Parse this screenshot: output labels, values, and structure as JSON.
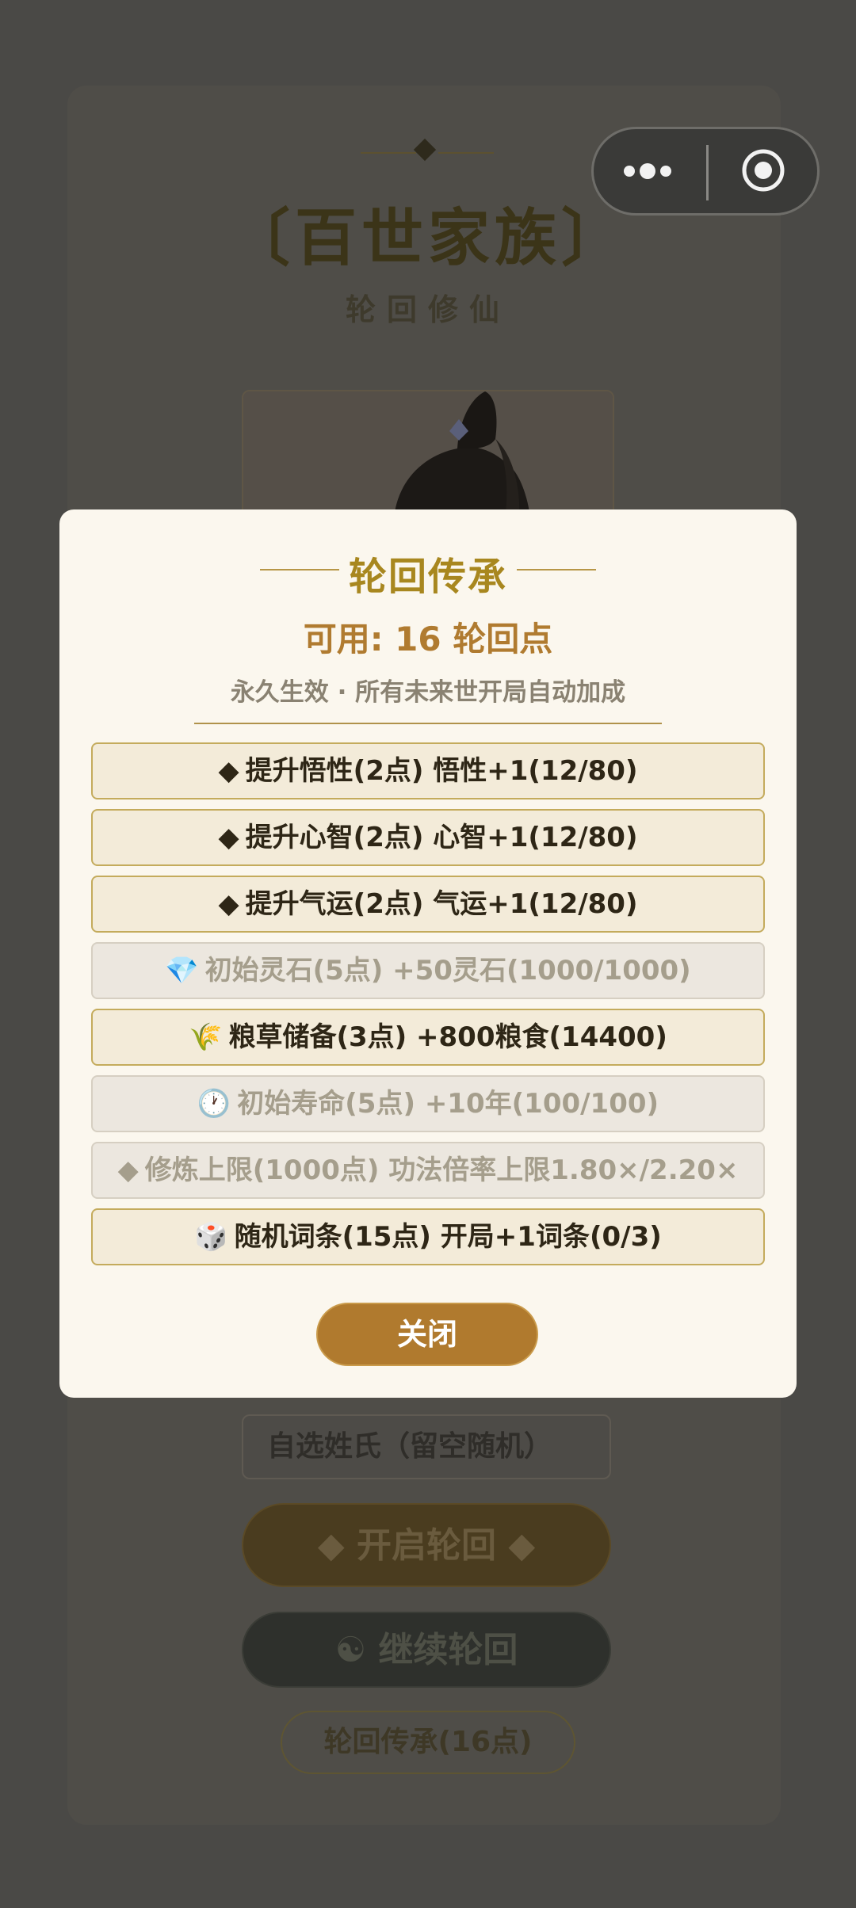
{
  "background": {
    "title": "〔百世家族〕",
    "subtitle": "轮回修仙",
    "surname_input": {
      "placeholder": "自选姓氏（留空随机）"
    },
    "start_button": "◆ 开启轮回 ◆",
    "continue_button": "☯ 继续轮回",
    "inherit_button": "轮回传承(16点)"
  },
  "modal": {
    "title": "轮回传承",
    "available_points": "可用: 16 轮回点",
    "description": "永久生效 · 所有未来世开局自动加成",
    "options": [
      {
        "icon": "◆",
        "label": "提升悟性(2点) 悟性+1(12/80)",
        "enabled": true
      },
      {
        "icon": "◆",
        "label": "提升心智(2点) 心智+1(12/80)",
        "enabled": true
      },
      {
        "icon": "◆",
        "label": "提升气运(2点) 气运+1(12/80)",
        "enabled": true
      },
      {
        "icon": "💎",
        "label": "初始灵石(5点) +50灵石(1000/1000)",
        "enabled": false
      },
      {
        "icon": "🌾",
        "label": "粮草储备(3点) +800粮食(14400)",
        "enabled": true
      },
      {
        "icon": "🕐",
        "label": "初始寿命(5点) +10年(100/100)",
        "enabled": false
      },
      {
        "icon": "◆",
        "label": "修炼上限(1000点) 功法倍率上限1.80×/2.20×",
        "enabled": false
      },
      {
        "icon": "🎲",
        "label": "随机词条(15点) 开局+1词条(0/3)",
        "enabled": true
      }
    ],
    "close_button": "关闭"
  },
  "colors": {
    "accent_gold": "#a8871f",
    "points_brown": "#b07b30",
    "close_button": "#b07a2e"
  }
}
